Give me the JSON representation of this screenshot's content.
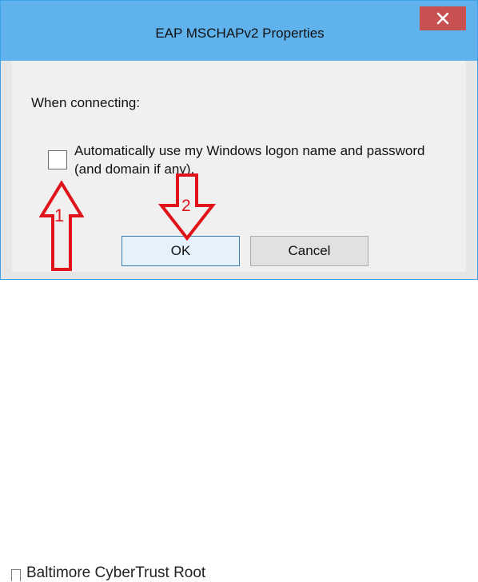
{
  "window": {
    "title": "EAP MSCHAPv2 Properties",
    "close_glyph": "✕"
  },
  "content": {
    "section_label": "When connecting:",
    "checkbox_label": "Automatically use my Windows logon name and password (and domain if any).",
    "checkbox_checked": false
  },
  "buttons": {
    "ok_label": "OK",
    "cancel_label": "Cancel"
  },
  "annotations": {
    "arrow_1_label": "1",
    "arrow_2_label": "2",
    "arrow_color": "#e0121a"
  },
  "background": {
    "partial_item_text": "Baltimore CyberTrust Root"
  },
  "colors": {
    "titlebar": "#5fb2ec",
    "close_button": "#c75050",
    "dialog_body": "#f0f0f0"
  }
}
